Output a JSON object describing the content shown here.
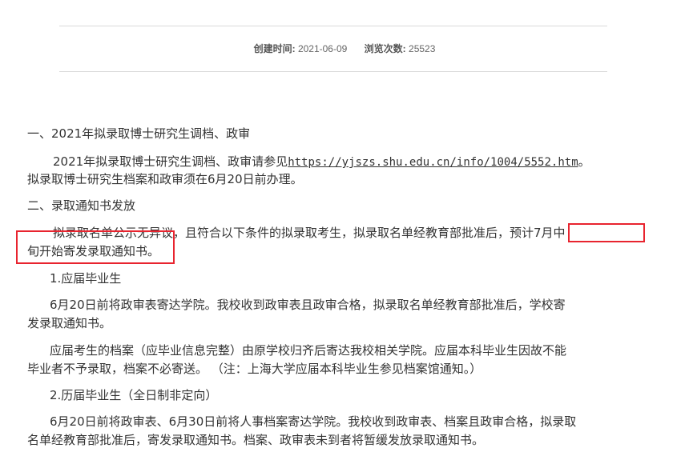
{
  "meta": {
    "created_label": "创建时间:",
    "created_value": "2021-06-09",
    "views_label": "浏览次数:",
    "views_value": "25523"
  },
  "content": {
    "h1": "一、2021年拟录取博士研究生调档、政审",
    "p1_line1_text": "2021年拟录取博士研究生调档、政审请参见",
    "p1_link": "https://yjszs.shu.edu.cn/info/1004/5552.htm",
    "p1_line1_tail": "。",
    "p1_line2": "拟录取博士研究生档案和政审须在6月20日前办理。",
    "h2": "二、录取通知书发放",
    "p2_line1_a": "拟录取名单公示无异议，且符合以下条件的拟录取考生，拟录取名单经教育部批准后，",
    "p2_line1_b": "预计7月中",
    "p2_line2": "旬开始寄发录取通知书。",
    "s1": "1.应届毕业生",
    "p3_line1": "6月20日前将政审表寄达学院。我校收到政审表且政审合格，拟录取名单经教育部批准后，学校寄",
    "p3_line2": "发录取通知书。",
    "p4_line1": "应届考生的档案（应毕业信息完整）由原学校归齐后寄达我校相关学院。应届本科毕业生因故不能",
    "p4_line2": "毕业者不予录取，档案不必寄送。 （注：上海大学应届本科毕业生参见档案馆通知。）",
    "s2": "2.历届毕业生（全日制非定向）",
    "p5_line1": "6月20日前将政审表、6月30日前将人事档案寄达学院。我校收到政审表、档案且政审合格，拟录取",
    "p5_line2": "名单经教育部批准后，寄发录取通知书。档案、政审表未到者将暂缓发放录取通知书。"
  },
  "colors": {
    "highlight": "#e8242f",
    "text": "#333333",
    "rule": "#d9d9d9"
  }
}
